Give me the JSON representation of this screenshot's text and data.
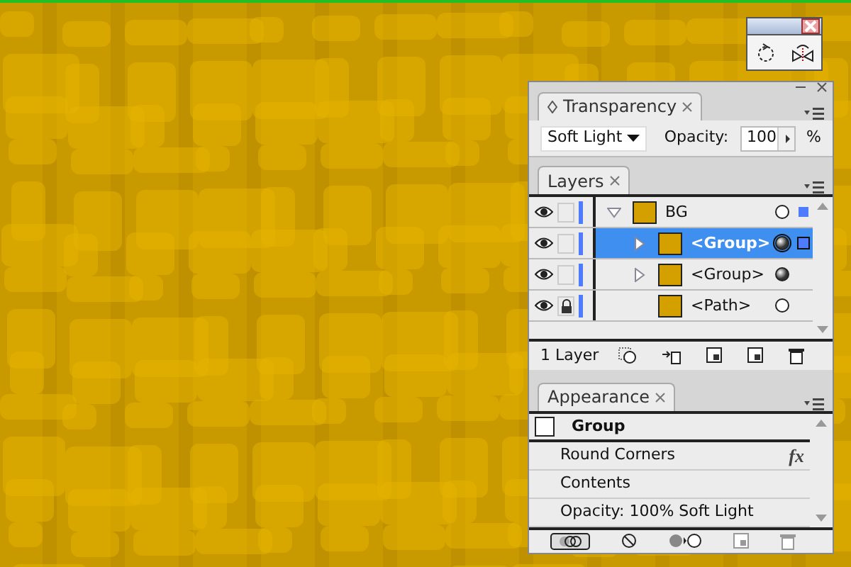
{
  "transparency_panel": {
    "tab": "Transparency",
    "blend_mode": "Soft Light",
    "opacity_label": "Opacity:",
    "opacity_value": "100",
    "unit": "%"
  },
  "layers_panel": {
    "tab": "Layers",
    "layers": [
      {
        "name": "BG",
        "visible": true,
        "locked": false,
        "expanded": true,
        "selected": false,
        "targeted": false,
        "has_appearance": false,
        "children": [
          {
            "name": "<Group>",
            "visible": true,
            "locked": false,
            "expanded": false,
            "selected": true,
            "targeted": true,
            "has_appearance": true
          },
          {
            "name": "<Group>",
            "visible": true,
            "locked": false,
            "expanded": false,
            "selected": false,
            "targeted": false,
            "has_appearance": true
          },
          {
            "name": "<Path>",
            "visible": true,
            "locked": true,
            "selected": false,
            "targeted": false,
            "has_appearance": false
          }
        ]
      }
    ],
    "footer": "1 Layer"
  },
  "appearance_panel": {
    "tab": "Appearance",
    "title": "Group",
    "rows": [
      {
        "label": "Round Corners",
        "badge": "fx"
      },
      {
        "label": "Contents"
      },
      {
        "label": "Opacity: 100% Soft Light"
      }
    ]
  }
}
